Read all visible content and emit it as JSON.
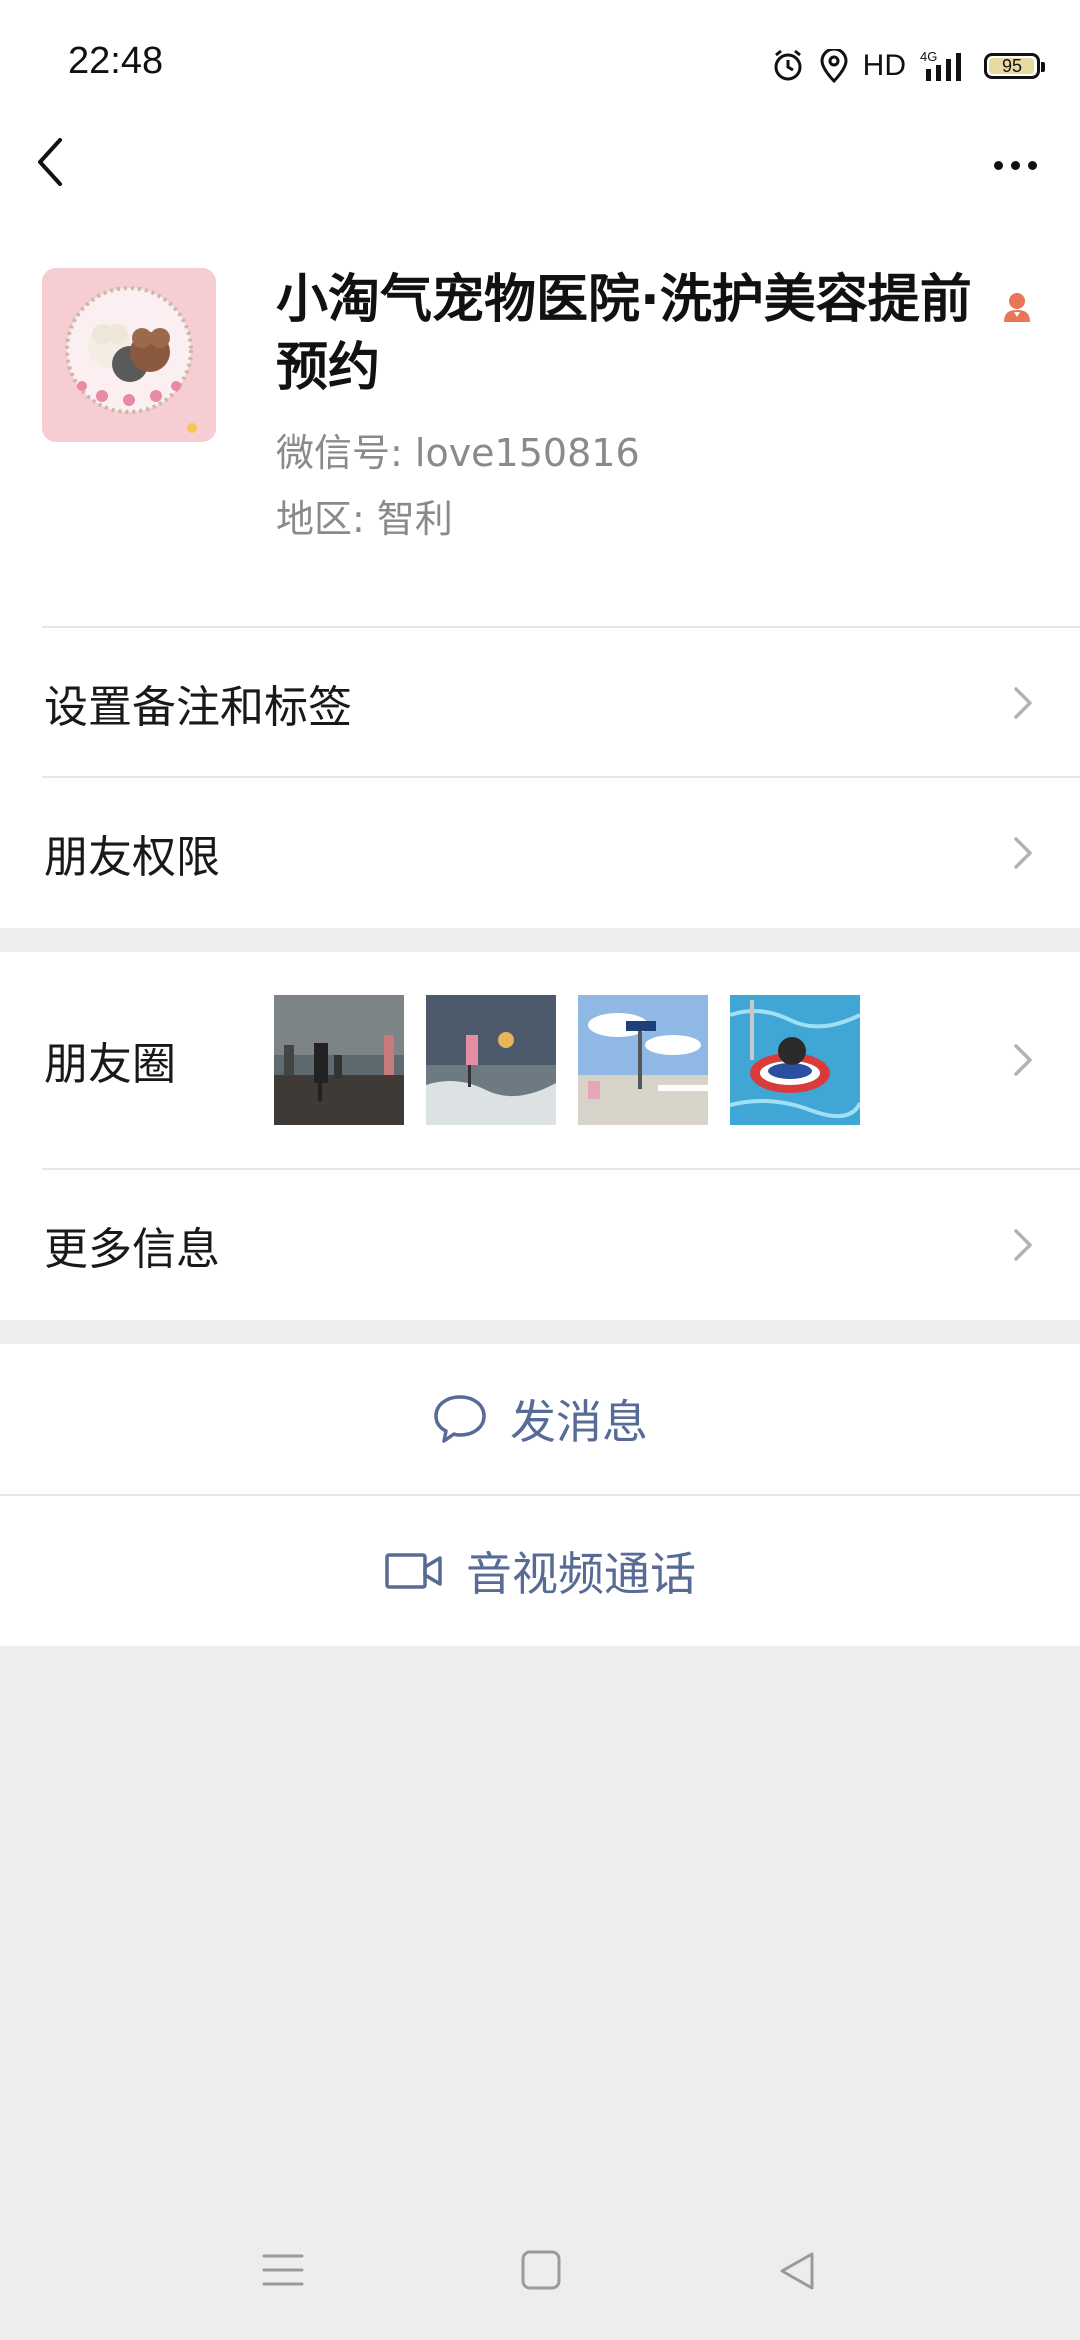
{
  "status_bar": {
    "time": "22:48",
    "hd": "HD",
    "network": "4G",
    "battery": "95",
    "icons": [
      "alarm-icon",
      "location-icon",
      "signal-icon",
      "battery-icon"
    ]
  },
  "nav": {
    "back_icon": "chevron-left-icon",
    "more_icon": "more-dots-icon"
  },
  "profile": {
    "name": "小淘气宠物医院·洗护美容提前预约",
    "wechat_id": "微信号: love150816",
    "region": "地区: 智利",
    "gender_icon": "female-gender-icon"
  },
  "rows": {
    "remark": "设置备注和标签",
    "permissions": "朋友权限",
    "moments": "朋友圈",
    "more_info": "更多信息"
  },
  "actions": {
    "message": "发消息",
    "video_call": "音视频通话"
  },
  "colors": {
    "accent_link": "#576b95",
    "background": "#ededed",
    "card": "#ffffff",
    "gender": "#e8775a"
  }
}
